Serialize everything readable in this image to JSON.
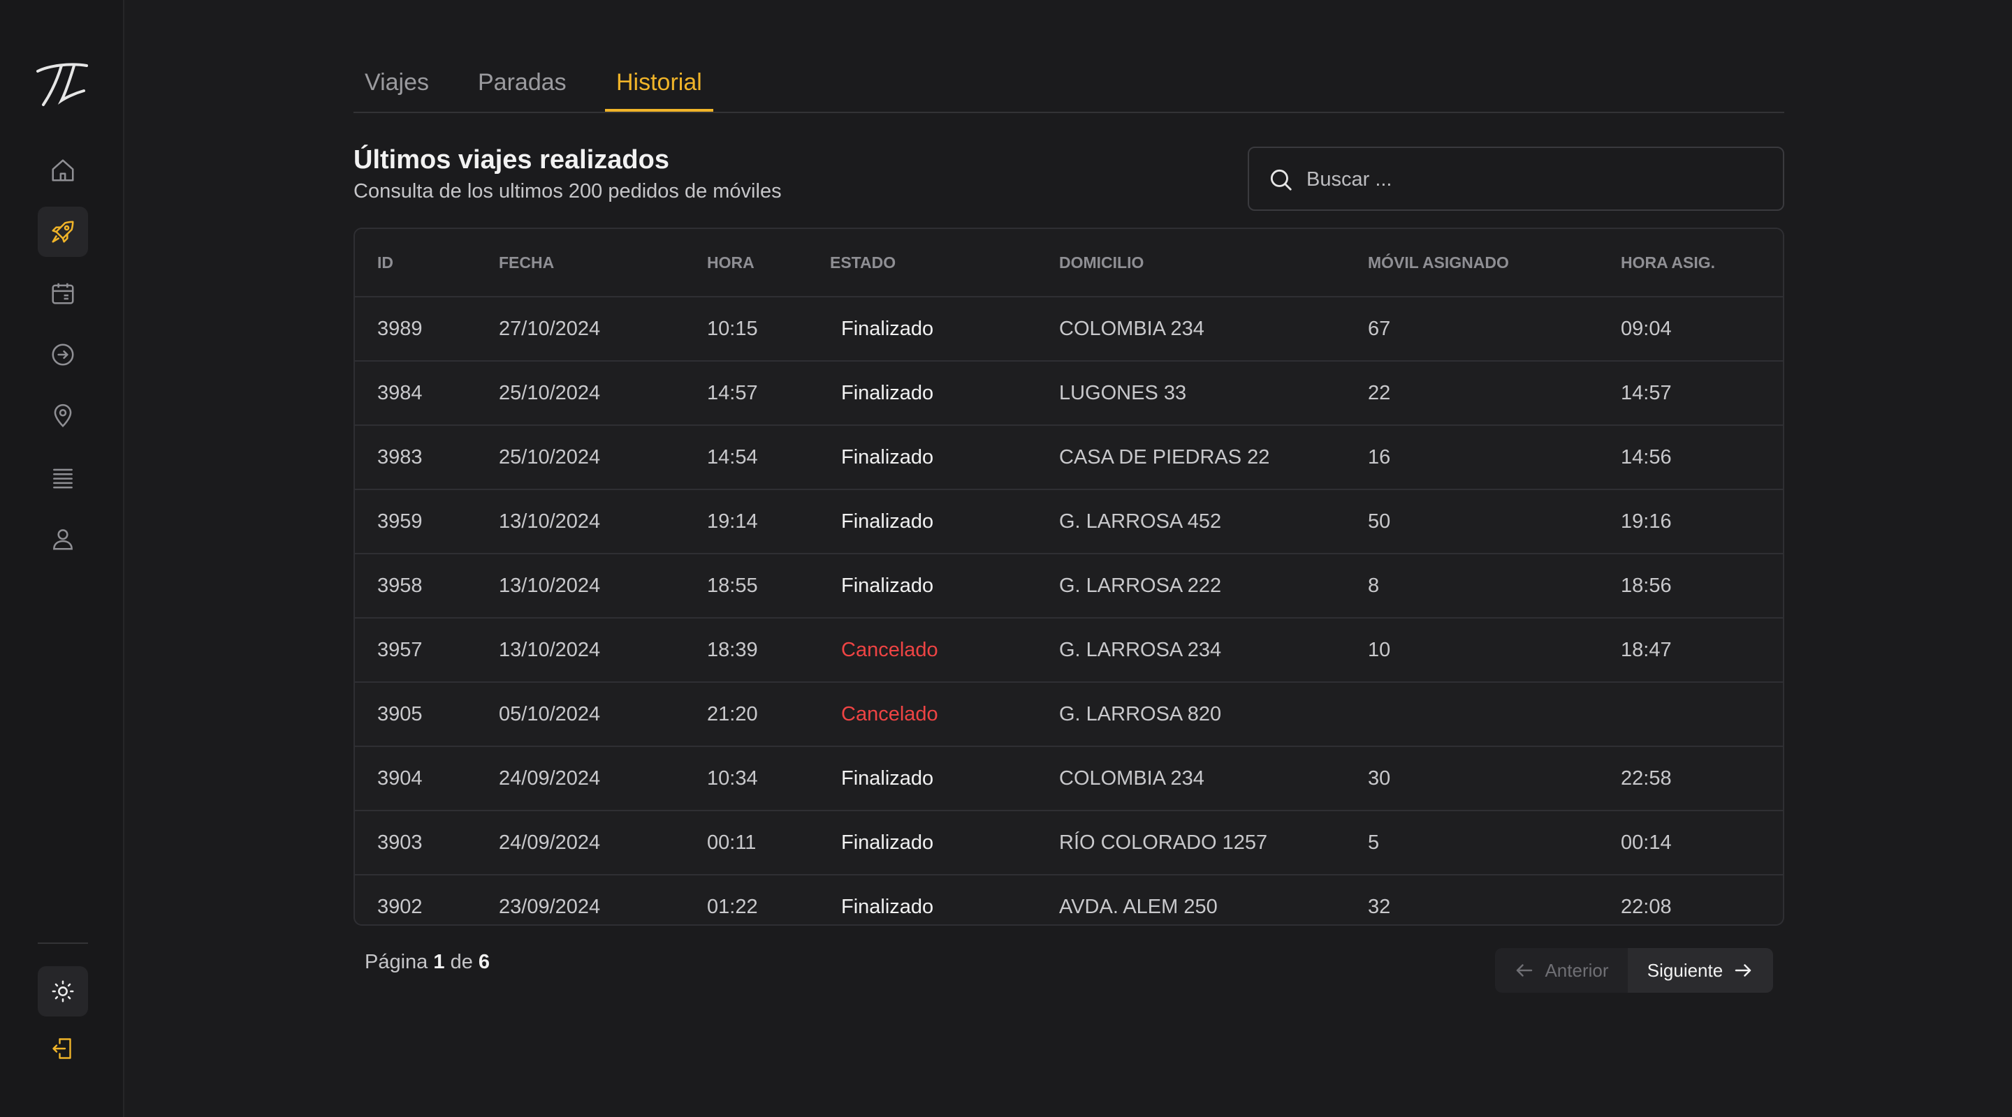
{
  "sidebar": {
    "items": [
      {
        "name": "home-icon",
        "active": false
      },
      {
        "name": "rocket-icon",
        "active": true
      },
      {
        "name": "calendar-icon",
        "active": false
      },
      {
        "name": "arrow-circle-icon",
        "active": false
      },
      {
        "name": "map-pin-icon",
        "active": false
      },
      {
        "name": "list-icon",
        "active": false
      },
      {
        "name": "user-icon",
        "active": false
      }
    ],
    "theme_icon": "sun-icon",
    "logout_icon": "logout-icon"
  },
  "colors": {
    "accent": "#f0b429",
    "cancel": "#ef4444",
    "background": "#1b1b1d"
  },
  "tabs": [
    {
      "label": "Viajes",
      "active": false
    },
    {
      "label": "Paradas",
      "active": false
    },
    {
      "label": "Historial",
      "active": true
    }
  ],
  "header": {
    "title": "Últimos viajes realizados",
    "subtitle": "Consulta de los ultimos 200 pedidos de móviles"
  },
  "search": {
    "placeholder": "Buscar ...",
    "value": ""
  },
  "table": {
    "columns": [
      "ID",
      "FECHA",
      "HORA",
      "ESTADO",
      "DOMICILIO",
      "MÓVIL ASIGNADO",
      "HORA ASIG."
    ],
    "rows": [
      {
        "id": "3989",
        "fecha": "27/10/2024",
        "hora": "10:15",
        "estado": "Finalizado",
        "domicilio": "COLOMBIA 234",
        "movil": "67",
        "hora_asig": "09:04"
      },
      {
        "id": "3984",
        "fecha": "25/10/2024",
        "hora": "14:57",
        "estado": "Finalizado",
        "domicilio": "LUGONES 33",
        "movil": "22",
        "hora_asig": "14:57"
      },
      {
        "id": "3983",
        "fecha": "25/10/2024",
        "hora": "14:54",
        "estado": "Finalizado",
        "domicilio": "CASA DE PIEDRAS 22",
        "movil": "16",
        "hora_asig": "14:56"
      },
      {
        "id": "3959",
        "fecha": "13/10/2024",
        "hora": "19:14",
        "estado": "Finalizado",
        "domicilio": "G. LARROSA 452",
        "movil": "50",
        "hora_asig": "19:16"
      },
      {
        "id": "3958",
        "fecha": "13/10/2024",
        "hora": "18:55",
        "estado": "Finalizado",
        "domicilio": "G. LARROSA 222",
        "movil": "8",
        "hora_asig": "18:56"
      },
      {
        "id": "3957",
        "fecha": "13/10/2024",
        "hora": "18:39",
        "estado": "Cancelado",
        "domicilio": "G. LARROSA 234",
        "movil": "10",
        "hora_asig": "18:47"
      },
      {
        "id": "3905",
        "fecha": "05/10/2024",
        "hora": "21:20",
        "estado": "Cancelado",
        "domicilio": "G. LARROSA 820",
        "movil": "",
        "hora_asig": ""
      },
      {
        "id": "3904",
        "fecha": "24/09/2024",
        "hora": "10:34",
        "estado": "Finalizado",
        "domicilio": "COLOMBIA 234",
        "movil": "30",
        "hora_asig": "22:58"
      },
      {
        "id": "3903",
        "fecha": "24/09/2024",
        "hora": "00:11",
        "estado": "Finalizado",
        "domicilio": "RÍO COLORADO 1257",
        "movil": "5",
        "hora_asig": "00:14"
      },
      {
        "id": "3902",
        "fecha": "23/09/2024",
        "hora": "01:22",
        "estado": "Finalizado",
        "domicilio": "AVDA. ALEM 250",
        "movil": "32",
        "hora_asig": "22:08"
      }
    ]
  },
  "pagination": {
    "prefix": "Página",
    "current": "1",
    "of": "de",
    "total": "6",
    "prev_label": "Anterior",
    "next_label": "Siguiente"
  }
}
